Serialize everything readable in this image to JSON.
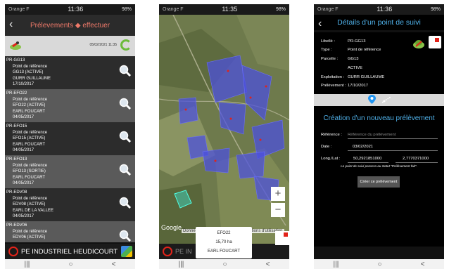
{
  "phones": [
    {
      "status": {
        "carrier": "Orange F",
        "time": "11:36",
        "right": "98%"
      },
      "header_title": "Prélevements ◆ effectuer",
      "toolbar_date": "05/02/2021 11:35",
      "items": [
        {
          "code": "PR-GG13",
          "type": "Point de référence",
          "parcel": "GG13 (ACTIVE)",
          "owner": "GURR GUILLAUME",
          "date": "17/10/2017"
        },
        {
          "code": "PR-EFO22",
          "type": "Point de référence",
          "parcel": "EFO22 (ACTIVE)",
          "owner": "EARL FOUCART",
          "date": "04/05/2017"
        },
        {
          "code": "PR-EFO15",
          "type": "Point de référence",
          "parcel": "EFO15 (ACTIVE)",
          "owner": "EARL FOUCART",
          "date": "04/05/2017"
        },
        {
          "code": "PR-EFO13",
          "type": "Point de référence",
          "parcel": "EFO13 (SORTIE)",
          "owner": "EARL FOUCART",
          "date": "04/05/2017"
        },
        {
          "code": "PR-EDV08",
          "type": "Point de référence",
          "parcel": "EDV08 (ACTIVE)",
          "owner": "EARL DE LA VALLEE",
          "date": "04/05/2017"
        },
        {
          "code": "PR-EDV06",
          "type": "Point de référence",
          "parcel": "EDV06 (ACTIVE)",
          "owner": "",
          "date": ""
        }
      ],
      "footer_name": "PE INDUSTRIEL HEUDICOURT"
    },
    {
      "status": {
        "carrier": "Orange F",
        "time": "11:35",
        "right": "98%"
      },
      "map": {
        "google": "Google",
        "map_data": "Données cartographiques",
        "terms": "Conditions d'utilisation",
        "zoom_in": "+",
        "zoom_out": "−"
      },
      "info": {
        "parcel": "EFO22",
        "area": "15,70 ha",
        "owner": "EARL FOUCART"
      },
      "footer_name": "PE IN"
    },
    {
      "status": {
        "carrier": "Orange F",
        "time": "11:36",
        "right": "98%"
      },
      "header_title": "Détails d'un point de suivi",
      "details": [
        {
          "label": "Libellé :",
          "value": "PR-GG13"
        },
        {
          "label": "Type :",
          "value": "Point de référence"
        },
        {
          "label": "Parcelle :",
          "value": "GG13"
        },
        {
          "label": "",
          "value": "ACTIVE"
        },
        {
          "label": "Exploitation :",
          "value": "GURR GUILLAUME"
        },
        {
          "label": "Prélèvement :",
          "value": "17/10/2017"
        }
      ],
      "creation_title": "Création d'un nouveau prélèvement",
      "ref_label": "Référence :",
      "ref_placeholder": "Référence du prélèvement",
      "date_label": "Date :",
      "date_value": "03/02/2021",
      "longlat_label": "Long./Lat :",
      "long_value": "50,2921851000",
      "lat_value": "2,7770371000",
      "note": "Le point de suivi passera au statut \"Prélèvement fait\".",
      "button_label": "Créer ce prélèvement"
    }
  ],
  "navbar": {
    "recents": "|||",
    "home": "○",
    "back": "<"
  }
}
